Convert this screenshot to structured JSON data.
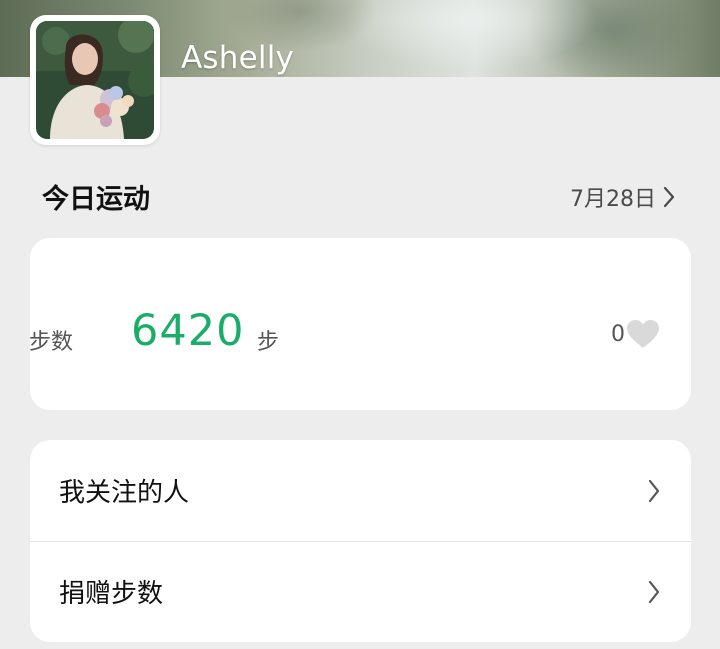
{
  "profile": {
    "username": "Ashelly",
    "avatar_icon": "profile-photo"
  },
  "today": {
    "title": "今日运动",
    "date": "7月28日",
    "date_arrow_icon": "chevron-right-icon"
  },
  "steps": {
    "label": "步数",
    "value": "6420",
    "unit": "步",
    "likes": "0",
    "like_icon": "heart-icon",
    "value_color": "#1aad68"
  },
  "menu": {
    "items": [
      {
        "label": "我关注的人",
        "icon": "chevron-right-icon"
      },
      {
        "label": "捐赠步数",
        "icon": "chevron-right-icon"
      }
    ]
  }
}
